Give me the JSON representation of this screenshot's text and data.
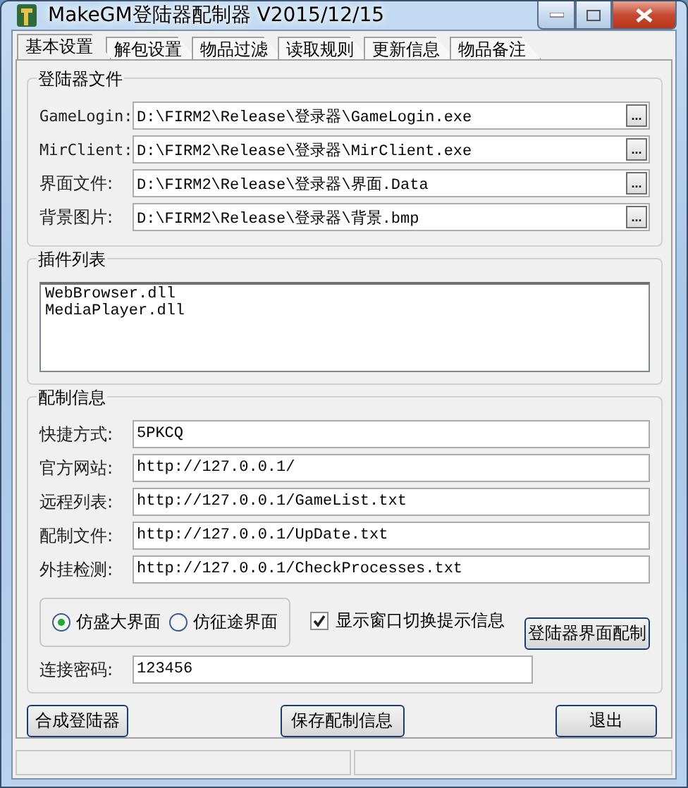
{
  "window": {
    "title": "MakeGM登陆器配制器 V2015/12/15"
  },
  "tabs": [
    {
      "label": "基本设置",
      "selected": true
    },
    {
      "label": "解包设置",
      "selected": false
    },
    {
      "label": "物品过滤",
      "selected": false
    },
    {
      "label": "读取规则",
      "selected": false
    },
    {
      "label": "更新信息",
      "selected": false
    },
    {
      "label": "物品备注",
      "selected": false
    }
  ],
  "files_group": {
    "title": "登陆器文件",
    "rows": [
      {
        "label": "GameLogin:",
        "value": "D:\\FIRM2\\Release\\登录器\\GameLogin.exe",
        "button": "..."
      },
      {
        "label": "MirClient:",
        "value": "D:\\FIRM2\\Release\\登录器\\MirClient.exe",
        "button": "..."
      },
      {
        "label": "界面文件:",
        "value": "D:\\FIRM2\\Release\\登录器\\界面.Data",
        "button": "..."
      },
      {
        "label": "背景图片:",
        "value": "D:\\FIRM2\\Release\\登录器\\背景.bmp",
        "button": "..."
      }
    ]
  },
  "plugins_group": {
    "title": "插件列表",
    "items": [
      "WebBrowser.dll",
      "MediaPlayer.dll"
    ]
  },
  "config_group": {
    "title": "配制信息",
    "rows": [
      {
        "label": "快捷方式:",
        "value": "5PKCQ"
      },
      {
        "label": "官方网站:",
        "value": "http://127.0.0.1/"
      },
      {
        "label": "远程列表:",
        "value": "http://127.0.0.1/GameList.txt"
      },
      {
        "label": "配制文件:",
        "value": "http://127.0.0.1/UpDate.txt"
      },
      {
        "label": "外挂检测:",
        "value": "http://127.0.0.1/CheckProcesses.txt"
      }
    ],
    "radios": [
      {
        "label": "仿盛大界面",
        "selected": true
      },
      {
        "label": "仿征途界面",
        "selected": false
      }
    ],
    "checkbox": {
      "label": "显示窗口切换提示信息",
      "checked": true
    },
    "config_button": "登陆器界面配制",
    "password": {
      "label": "连接密码:",
      "value": "123456"
    }
  },
  "buttons": [
    "合成登陆器",
    "保存配制信息",
    "退出"
  ]
}
